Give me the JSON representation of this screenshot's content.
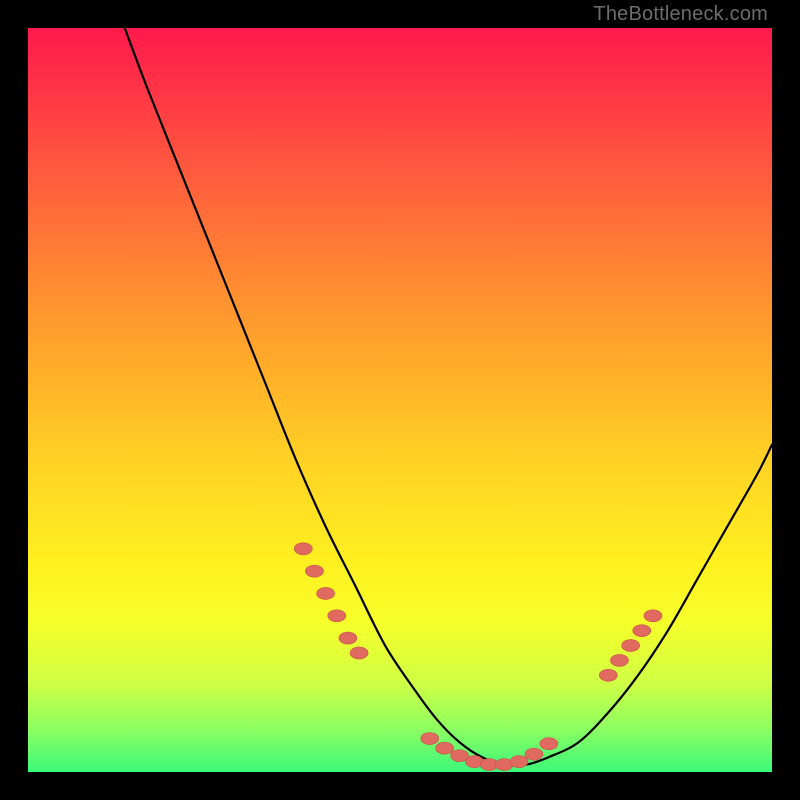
{
  "watermark": "TheBottleneck.com",
  "colors": {
    "curve_stroke": "#000000",
    "marker_fill": "#e06a60",
    "marker_stroke": "#c85046"
  },
  "chart_data": {
    "type": "line",
    "title": "",
    "xlabel": "",
    "ylabel": "",
    "xlim": [
      0,
      100
    ],
    "ylim": [
      0,
      100
    ],
    "note": "Axes are unlabeled in the source image. x is normalized 0-100 left→right, y is normalized 0-100 bottom→top (so high values = red/top, low = green/bottom).",
    "series": [
      {
        "name": "bottleneck-curve",
        "x": [
          13,
          16,
          20,
          24,
          28,
          32,
          36,
          40,
          44,
          48,
          52,
          55,
          58,
          61,
          64,
          67,
          70,
          74,
          78,
          82,
          86,
          90,
          94,
          98,
          100
        ],
        "y": [
          100,
          92,
          82,
          72,
          62,
          52,
          42,
          33,
          25,
          17,
          11,
          7,
          4,
          2,
          1,
          1,
          2,
          4,
          8,
          13,
          19,
          26,
          33,
          40,
          44
        ]
      }
    ],
    "markers": {
      "note": "dashed-looking salmon overlay near the valley and on short segments of both walls",
      "left_wall": {
        "x": [
          37,
          38.5,
          40,
          41.5,
          43,
          44.5
        ],
        "y": [
          30,
          27,
          24,
          21,
          18,
          16
        ]
      },
      "valley": {
        "x": [
          54,
          56,
          58,
          60,
          62,
          64,
          66,
          68,
          70
        ],
        "y": [
          4.5,
          3.2,
          2.2,
          1.4,
          1.0,
          1.0,
          1.4,
          2.4,
          3.8
        ]
      },
      "right_wall": {
        "x": [
          78,
          79.5,
          81,
          82.5,
          84
        ],
        "y": [
          13,
          15,
          17,
          19,
          21
        ]
      }
    }
  }
}
